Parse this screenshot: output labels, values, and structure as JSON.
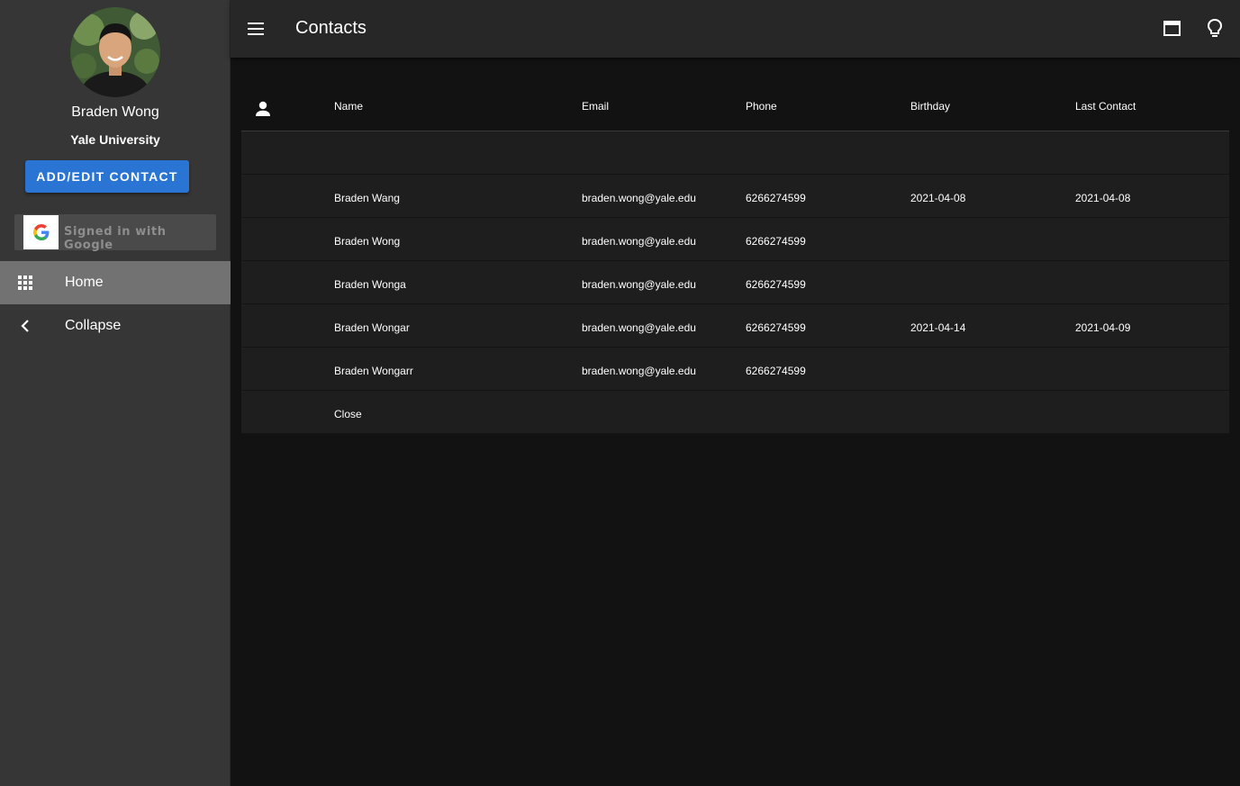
{
  "sidebar": {
    "profile": {
      "name": "Braden Wong",
      "school": "Yale University"
    },
    "add_button_label": "ADD/EDIT CONTACT",
    "google_label": "Signed in with Google",
    "nav": [
      {
        "label": "Home",
        "icon": "apps-grid-icon",
        "active": true
      },
      {
        "label": "Collapse",
        "icon": "chevron-left-icon",
        "active": false
      }
    ]
  },
  "header": {
    "title": "Contacts",
    "icons": [
      "menu-icon",
      "window-icon",
      "lightbulb-icon"
    ]
  },
  "table": {
    "columns": [
      "Name",
      "Email",
      "Phone",
      "Birthday",
      "Last Contact"
    ],
    "rows": [
      {
        "name": "Braden Wang",
        "email": "braden.wong@yale.edu",
        "phone": "6266274599",
        "birthday": "2021-04-08",
        "last_contact": "2021-04-08"
      },
      {
        "name": "Braden Wong",
        "email": "braden.wong@yale.edu",
        "phone": "6266274599",
        "birthday": "",
        "last_contact": ""
      },
      {
        "name": "Braden Wonga",
        "email": "braden.wong@yale.edu",
        "phone": "6266274599",
        "birthday": "",
        "last_contact": ""
      },
      {
        "name": "Braden Wongar",
        "email": "braden.wong@yale.edu",
        "phone": "6266274599",
        "birthday": "2021-04-14",
        "last_contact": "2021-04-09"
      },
      {
        "name": "Braden Wongarr",
        "email": "braden.wong@yale.edu",
        "phone": "6266274599",
        "birthday": "",
        "last_contact": ""
      }
    ],
    "close_label": "Close"
  },
  "colors": {
    "sidebar_bg": "#363636",
    "topbar_bg": "#272727",
    "content_bg": "#121212",
    "row_bg": "#1e1e1e",
    "accent": "#2a74d4",
    "nav_active": "#727272"
  }
}
